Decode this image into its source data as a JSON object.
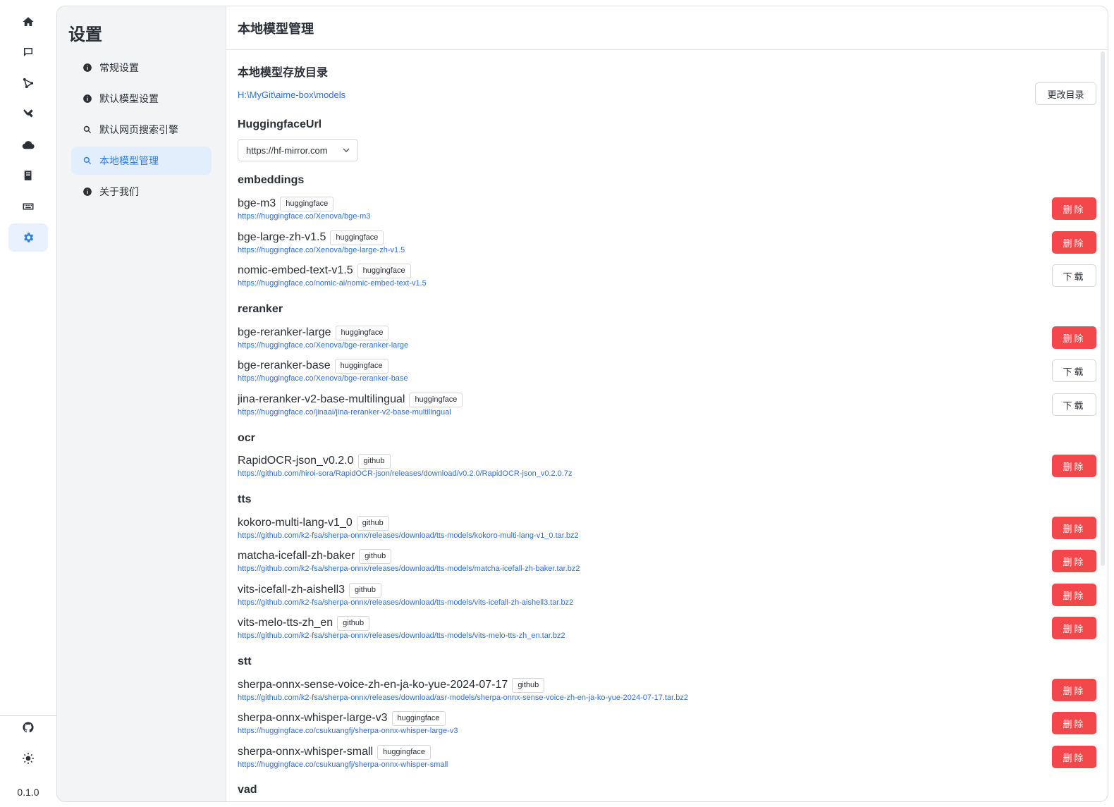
{
  "rail": {
    "items": [
      "home-icon",
      "chat-icon",
      "network-icon",
      "tools-icon",
      "cloud-icon",
      "book-icon",
      "keyboard-icon",
      "settings-icon"
    ],
    "bottom": [
      "github-icon",
      "theme-icon"
    ],
    "version": "0.1.0",
    "active": "settings-icon",
    "accent_color": "#2f7de1"
  },
  "settings": {
    "title": "设置",
    "nav": [
      {
        "label": "常规设置",
        "icon": "info-icon"
      },
      {
        "label": "默认模型设置",
        "icon": "info-icon"
      },
      {
        "label": "默认网页搜索引擎",
        "icon": "search-icon"
      },
      {
        "label": "本地模型管理",
        "icon": "search-icon",
        "active": true
      },
      {
        "label": "关于我们",
        "icon": "info-icon"
      }
    ]
  },
  "main": {
    "header": "本地模型管理",
    "storage": {
      "title": "本地模型存放目录",
      "path": "H:\\MyGit\\aime-box\\models",
      "change_button": "更改目录"
    },
    "hf": {
      "title": "HuggingfaceUrl",
      "value": "https://hf-mirror.com"
    },
    "labels": {
      "delete": "删除",
      "download": "下载"
    },
    "colors": {
      "delete_bg": "#f2484b",
      "link": "#2f6fd0"
    },
    "sections": [
      {
        "title": "embeddings",
        "models": [
          {
            "name": "bge-m3",
            "tag": "huggingface",
            "url": "https://huggingface.co/Xenova/bge-m3",
            "action": "delete"
          },
          {
            "name": "bge-large-zh-v1.5",
            "tag": "huggingface",
            "url": "https://huggingface.co/Xenova/bge-large-zh-v1.5",
            "action": "delete"
          },
          {
            "name": "nomic-embed-text-v1.5",
            "tag": "huggingface",
            "url": "https://huggingface.co/nomic-ai/nomic-embed-text-v1.5",
            "action": "download"
          }
        ]
      },
      {
        "title": "reranker",
        "models": [
          {
            "name": "bge-reranker-large",
            "tag": "huggingface",
            "url": "https://huggingface.co/Xenova/bge-reranker-large",
            "action": "delete"
          },
          {
            "name": "bge-reranker-base",
            "tag": "huggingface",
            "url": "https://huggingface.co/Xenova/bge-reranker-base",
            "action": "download"
          },
          {
            "name": "jina-reranker-v2-base-multilingual",
            "tag": "huggingface",
            "url": "https://huggingface.co/jinaai/jina-reranker-v2-base-multilingual",
            "action": "download"
          }
        ]
      },
      {
        "title": "ocr",
        "models": [
          {
            "name": "RapidOCR-json_v0.2.0",
            "tag": "github",
            "url": "https://github.com/hiroi-sora/RapidOCR-json/releases/download/v0.2.0/RapidOCR-json_v0.2.0.7z",
            "action": "delete"
          }
        ]
      },
      {
        "title": "tts",
        "models": [
          {
            "name": "kokoro-multi-lang-v1_0",
            "tag": "github",
            "url": "https://github.com/k2-fsa/sherpa-onnx/releases/download/tts-models/kokoro-multi-lang-v1_0.tar.bz2",
            "action": "delete"
          },
          {
            "name": "matcha-icefall-zh-baker",
            "tag": "github",
            "url": "https://github.com/k2-fsa/sherpa-onnx/releases/download/tts-models/matcha-icefall-zh-baker.tar.bz2",
            "action": "delete"
          },
          {
            "name": "vits-icefall-zh-aishell3",
            "tag": "github",
            "url": "https://github.com/k2-fsa/sherpa-onnx/releases/download/tts-models/vits-icefall-zh-aishell3.tar.bz2",
            "action": "delete"
          },
          {
            "name": "vits-melo-tts-zh_en",
            "tag": "github",
            "url": "https://github.com/k2-fsa/sherpa-onnx/releases/download/tts-models/vits-melo-tts-zh_en.tar.bz2",
            "action": "delete"
          }
        ]
      },
      {
        "title": "stt",
        "models": [
          {
            "name": "sherpa-onnx-sense-voice-zh-en-ja-ko-yue-2024-07-17",
            "tag": "github",
            "url": "https://github.com/k2-fsa/sherpa-onnx/releases/download/asr-models/sherpa-onnx-sense-voice-zh-en-ja-ko-yue-2024-07-17.tar.bz2",
            "action": "delete"
          },
          {
            "name": "sherpa-onnx-whisper-large-v3",
            "tag": "huggingface",
            "url": "https://huggingface.co/csukuangfj/sherpa-onnx-whisper-large-v3",
            "action": "delete"
          },
          {
            "name": "sherpa-onnx-whisper-small",
            "tag": "huggingface",
            "url": "https://huggingface.co/csukuangfj/sherpa-onnx-whisper-small",
            "action": "delete"
          }
        ]
      },
      {
        "title": "vad",
        "models": []
      }
    ]
  }
}
